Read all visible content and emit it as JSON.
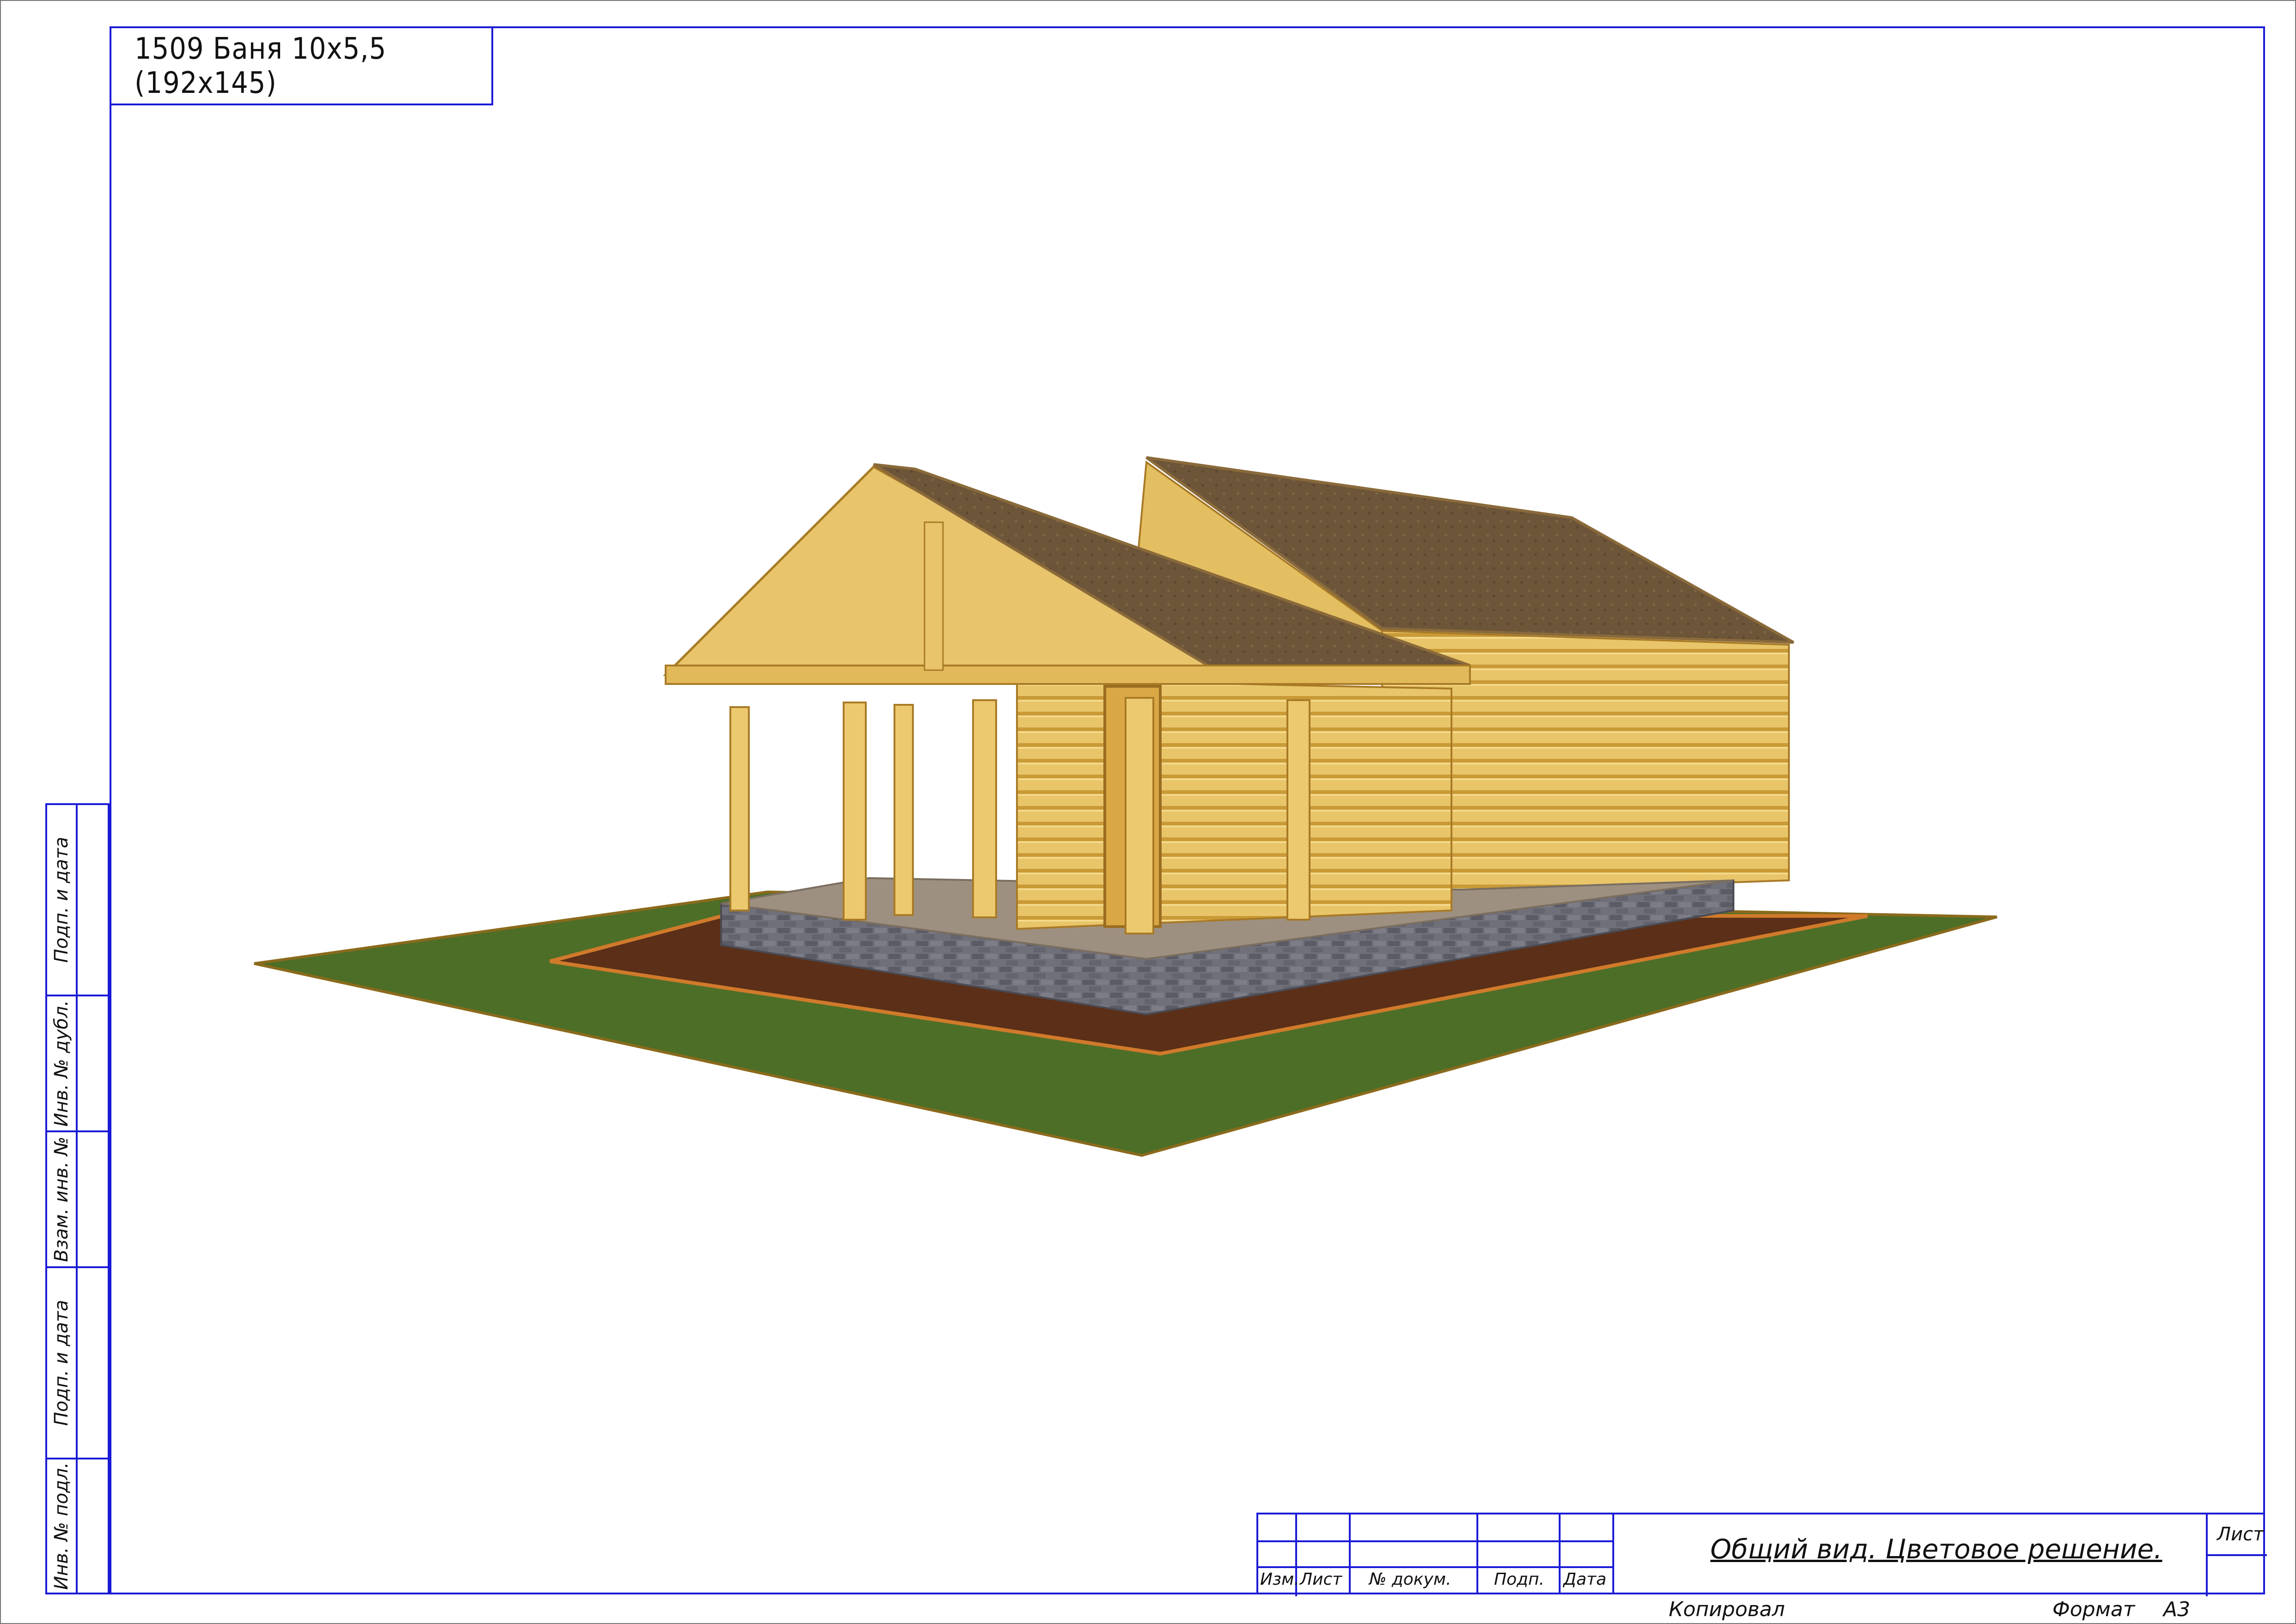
{
  "sheet": {
    "title": "1509 Баня 10х5,5 (192х145)",
    "view_title": "Общий вид. Цветовое решение.",
    "footer": {
      "copied": "Копировал",
      "format_label": "Формат",
      "format_value": "А3"
    },
    "stamp_headers": [
      "Изм.",
      "Лист",
      "№ докум.",
      "Подп.",
      "Дата"
    ],
    "sheet_label": "Лист"
  },
  "side_labels": [
    "Подп. и дата",
    "Инв. № дубл.",
    "Взам. инв. №",
    "Подп. и дата",
    "Инв. № подл."
  ],
  "colors": {
    "frame": "#1a1ad6",
    "grass": "#4a6b26",
    "soil": "#5a3018",
    "logs": "#e7c063",
    "logs_dark": "#c9982f",
    "roof": "#6b5338",
    "plinth": "#6b6b73",
    "deck": "#9b8d7c"
  }
}
